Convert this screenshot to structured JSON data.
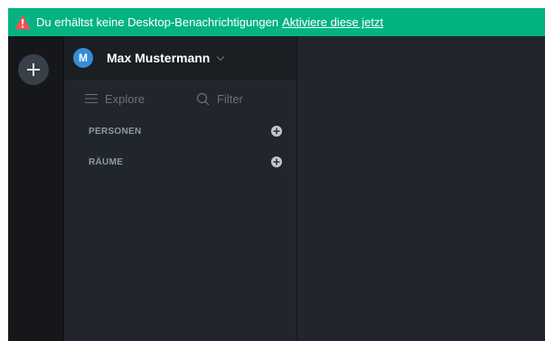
{
  "banner": {
    "message": "Du erhältst keine Desktop-Benachrichtigungen",
    "link": "Aktiviere diese jetzt",
    "icon": "warning-triangle-icon",
    "background": "#03b381"
  },
  "rail": {
    "add_icon": "plus-icon"
  },
  "user": {
    "initial": "M",
    "name": "Max Mustermann",
    "avatar_color": "#368bd6"
  },
  "search": {
    "explore_label": "Explore",
    "filter_placeholder": "Filter"
  },
  "sections": [
    {
      "label": "PERSONEN"
    },
    {
      "label": "RÄUME"
    }
  ]
}
